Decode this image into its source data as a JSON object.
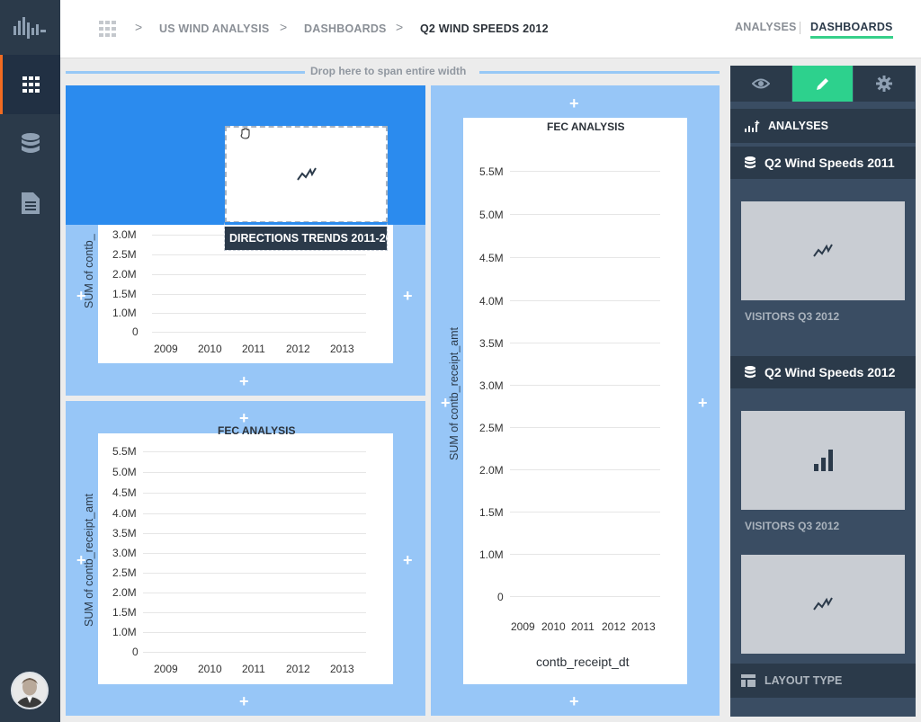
{
  "breadcrumb": {
    "items": [
      "US WIND ANALYSIS",
      "DASHBOARDS",
      "Q2 WIND SPEEDS 2012"
    ],
    "separator": ">"
  },
  "nav": {
    "analyses": "ANALYSES",
    "dashboards": "DASHBOARDS"
  },
  "canvas": {
    "drop_hint": "Drop here to span entire width",
    "add_symbol": "+"
  },
  "drag": {
    "ghost_label": "DIRECTIONS TRENDS 2011-20",
    "icon": "line-chart-icon"
  },
  "right_panel": {
    "tabs": [
      {
        "icon": "eye-icon"
      },
      {
        "icon": "pencil-icon"
      },
      {
        "icon": "gear-icon"
      }
    ],
    "header": "ANALYSES",
    "groups": [
      {
        "title": "Q2 Wind Speeds 2011",
        "items": [
          {
            "label": "VISITORS Q3 2012",
            "icon": "line-chart-icon"
          }
        ]
      },
      {
        "title": "Q2 Wind Speeds 2012",
        "items": [
          {
            "label": "VISITORS Q3 2012",
            "icon": "bar-chart-icon"
          },
          {
            "label": "",
            "icon": "line-chart-icon"
          }
        ]
      }
    ],
    "footer": "LAYOUT TYPE"
  },
  "colors": {
    "accent_green": "#2dd18d",
    "accent_orange": "#f26b21",
    "panel_blue": "#97c6f7",
    "highlight_blue": "#2b8bee",
    "sidebar": "#2b3a4a"
  },
  "chart_data": [
    {
      "type": "line",
      "title": "",
      "ylabel": "SUM of contb_",
      "x": [
        "2009",
        "2010",
        "2011",
        "2012",
        "2013"
      ],
      "y_ticks": [
        "0",
        "1.0M",
        "1.5M",
        "2.0M",
        "2.5M",
        "3.0M"
      ],
      "series": []
    },
    {
      "type": "line",
      "title": "FEC ANALYSIS",
      "ylabel": "SUM of contb_receipt_amt",
      "xlabel": "",
      "x": [
        "2009",
        "2010",
        "2011",
        "2012",
        "2013"
      ],
      "y_ticks": [
        "0",
        "1.0M",
        "1.5M",
        "2.0M",
        "2.5M",
        "3.0M",
        "3.5M",
        "4.0M",
        "4.5M",
        "5.0M",
        "5.5M"
      ],
      "series": []
    },
    {
      "type": "line",
      "title": "FEC ANALYSIS",
      "ylabel": "SUM of contb_receipt_amt",
      "xlabel": "contb_receipt_dt",
      "x": [
        "2009",
        "2010",
        "2011",
        "2012",
        "2013"
      ],
      "y_ticks": [
        "0",
        "1.0M",
        "1.5M",
        "2.0M",
        "2.5M",
        "3.0M",
        "3.5M",
        "4.0M",
        "4.5M",
        "5.0M",
        "5.5M"
      ],
      "series": []
    }
  ]
}
